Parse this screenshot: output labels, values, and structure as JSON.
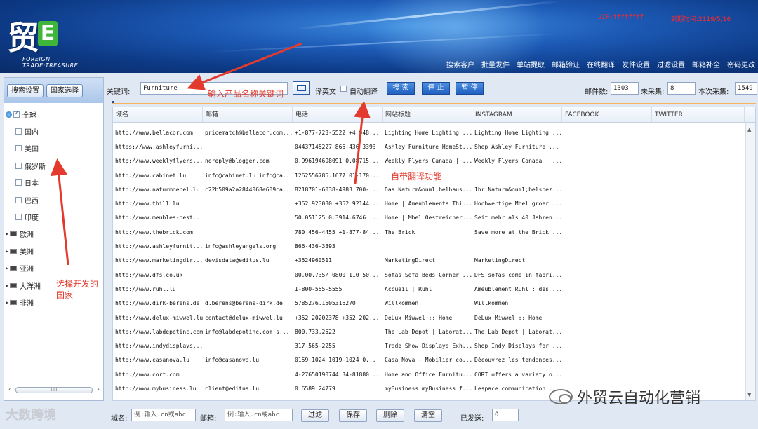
{
  "header": {
    "logo_text": "贸",
    "logo_sub": "FOREIGN TRADE·TREASURE",
    "vip": "VIP:ffffffff",
    "expire": "到期时间:2119/5/16",
    "nav": [
      "搜索客户",
      "批量发件",
      "单站提取",
      "邮箱验证",
      "在线翻译",
      "发件设置",
      "过滤设置",
      "邮箱补全",
      "密码更改"
    ]
  },
  "left": {
    "tabs": [
      "搜索设置",
      "国家选择"
    ],
    "tree": [
      {
        "label": "全球",
        "type": "root",
        "checked": true
      },
      {
        "label": "国内",
        "type": "child"
      },
      {
        "label": "美国",
        "type": "child"
      },
      {
        "label": "俄罗斯",
        "type": "child"
      },
      {
        "label": "日本",
        "type": "child"
      },
      {
        "label": "巴西",
        "type": "child"
      },
      {
        "label": "印度",
        "type": "child"
      },
      {
        "label": "欧洲",
        "type": "group"
      },
      {
        "label": "美洲",
        "type": "group"
      },
      {
        "label": "亚洲",
        "type": "group"
      },
      {
        "label": "大洋洲",
        "type": "group"
      },
      {
        "label": "非洲",
        "type": "group"
      }
    ],
    "scroll_label": "IIIII"
  },
  "toolbar": {
    "keyword_label": "关键词:",
    "keyword_value": "Furniture",
    "translate_label": "译英文",
    "auto_translate_label": "自动翻译",
    "search_btn": "搜 索",
    "stop_btn": "停 止",
    "pause_btn": "暂 停",
    "mail_count_label": "邮件数:",
    "mail_count": "1303",
    "uncollected_label": "未采集:",
    "uncollected": "8",
    "this_collect_label": "本次采集:",
    "this_collect": "1549"
  },
  "grid": {
    "columns": [
      "域名",
      "邮箱",
      "电话",
      "网站标题",
      "INSTAGRAM",
      "FACEBOOK",
      "TWITTER"
    ],
    "rows": [
      [
        "http://www.bellacor.com",
        "pricematch@bellacor.com...",
        "+1-877-723-5522  +4 948...",
        "Lighting Home Lighting ...",
        "Lighting Home Lighting ...",
        "",
        ""
      ],
      [
        "https://www.ashleyfurni...",
        "",
        "04437145227 866-436-3393",
        "Ashley Furniture HomeSt...",
        " Shop Ashley Furniture ...",
        "",
        ""
      ],
      [
        "http://www.weeklyflyers...",
        "noreply@blogger.com",
        "0.996194698091  0.08715...",
        "Weekly Flyers Canada | ...",
        "Weekly Flyers Canada | ...",
        "",
        ""
      ],
      [
        "http://www.cabinet.lu",
        "info@cabinet.lu info@ca...",
        "1262556785.1677  01-170...",
        "",
        "",
        "",
        ""
      ],
      [
        "http://www.naturmoebel.lu",
        "c22b509a2a2844068e609ca...",
        "8218701-6038-4983  700-...",
        "Das Naturm&ouml;belhaus...",
        "Ihr Naturm&ouml;belspez...",
        "",
        ""
      ],
      [
        "http://www.thill.lu",
        "",
        "+352 923030  +352 92144...",
        "Home | Ameublements Thi...",
        "Hochwertige Mbel groer ...",
        "",
        ""
      ],
      [
        "http://www.meubles-oest...",
        "",
        "50.051125  0.3914.6746 ...",
        "Home | Mbel Oestreicher...",
        "Seit mehr als 40 Jahren...",
        "",
        ""
      ],
      [
        "http://www.thebrick.com",
        "",
        "780 456-4455  +1-877-84...",
        "The Brick",
        "Save more at the Brick ...",
        "",
        ""
      ],
      [
        "http://www.ashleyfurnit...",
        "info@ashleyangels.org",
        "866-436-3393",
        "",
        "",
        "",
        ""
      ],
      [
        "http://www.marketingdir...",
        "devisdata@editus.lu",
        "+3524960511",
        "MarketingDirect",
        "MarketingDirect",
        "",
        ""
      ],
      [
        "http://www.dfs.co.uk",
        "",
        "00.00.735/  0800 110 50...",
        "Sofas Sofa Beds Corner ...",
        "DFS sofas come in fabri...",
        "",
        ""
      ],
      [
        "http://www.ruhl.lu",
        "",
        "1-800-555-5555",
        "Accueil | Ruhl",
        "Ameublement Ruhl : des ...",
        "",
        ""
      ],
      [
        "http://www.dirk-berens.de",
        "d.berens@berens-dirk.de",
        "5785276.1505316270",
        "Willkommen",
        "Willkommen",
        "",
        ""
      ],
      [
        "http://www.delux-miwwel.lu",
        "contact@delux-miwwel.lu",
        "+352 20202378  +352 202...",
        "DeLux Miwwel :: Home",
        "DeLux Miwwel :: Home",
        "",
        ""
      ],
      [
        "http://www.labdepotinc.com",
        "info@labdepotinc.com  s...",
        "800.733.2522",
        "The Lab Depot | Laborat...",
        "The Lab Depot | Laborat...",
        "",
        ""
      ],
      [
        "http://www.indydisplays...",
        "",
        "317-565-2255",
        "Trade Show Displays Exh...",
        "Shop Indy Displays for ...",
        "",
        ""
      ],
      [
        "http://www.casanova.lu",
        "info@casanova.lu",
        "0159-1024  1019-1024  0...",
        "Casa Nova - Mobilier co...",
        "Découvrez les tendances...",
        "",
        ""
      ],
      [
        "http://www.cort.com",
        "",
        "4-27650190744  34-81880...",
        "Home and Office Furnitu...",
        "CORT offers a variety o...",
        "",
        ""
      ],
      [
        "http://www.mybusiness.lu",
        "client@editus.lu",
        "0.6589.24779",
        "myBusiness myBusiness f...",
        "Lespace communication ...",
        "",
        ""
      ]
    ]
  },
  "bottom": {
    "domain_label": "域名:",
    "domain_placeholder": "例:输入.cn或abc",
    "email_label": "邮箱:",
    "email_placeholder": "例:输入.cn或abc",
    "filter_btn": "过滤",
    "save_btn": "保存",
    "delete_btn": "删除",
    "clear_btn": "清空",
    "sent_label": "已发送:",
    "sent_value": "0"
  },
  "annotations": {
    "keyword_hint": "输入产品名称关键词",
    "translate_hint": "自带翻译功能",
    "country_hint_1": "选择开发的",
    "country_hint_2": "国家"
  },
  "watermarks": {
    "left": "大数跨境",
    "right": "外贸云自动化营销"
  },
  "colors": {
    "accent": "#1f5fc0",
    "annotation": "#e23b2e",
    "alert": "#ff2a2a"
  }
}
